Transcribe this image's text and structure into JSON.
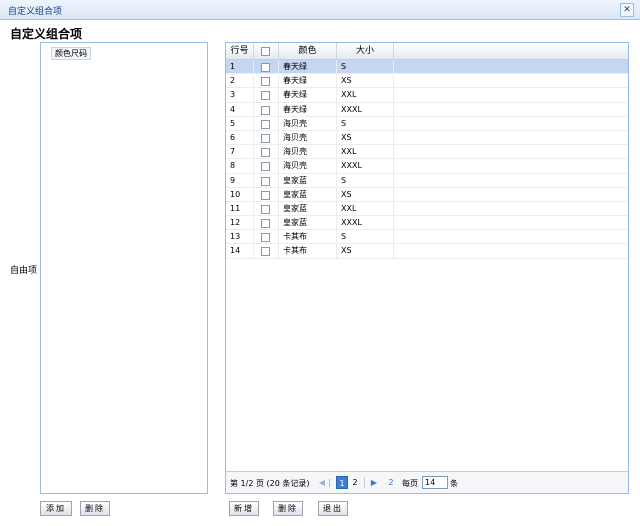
{
  "window": {
    "title": "自定义组合项",
    "close_glyph": "✕"
  },
  "dialog": {
    "heading": "自定义组合项",
    "side_label": "自由项"
  },
  "left_panel": {
    "chip_label": "颜色尺码"
  },
  "grid": {
    "columns": {
      "rownum": "行号",
      "color": "颜色",
      "size": "大小"
    },
    "rows": [
      {
        "n": "1",
        "color": "春天绿",
        "size": "S"
      },
      {
        "n": "2",
        "color": "春天绿",
        "size": "XS"
      },
      {
        "n": "3",
        "color": "春天绿",
        "size": "XXL"
      },
      {
        "n": "4",
        "color": "春天绿",
        "size": "XXXL"
      },
      {
        "n": "5",
        "color": "海贝壳",
        "size": "S"
      },
      {
        "n": "6",
        "color": "海贝壳",
        "size": "XS"
      },
      {
        "n": "7",
        "color": "海贝壳",
        "size": "XXL"
      },
      {
        "n": "8",
        "color": "海贝壳",
        "size": "XXXL"
      },
      {
        "n": "9",
        "color": "皇家蓝",
        "size": "S"
      },
      {
        "n": "10",
        "color": "皇家蓝",
        "size": "XS"
      },
      {
        "n": "11",
        "color": "皇家蓝",
        "size": "XXL"
      },
      {
        "n": "12",
        "color": "皇家蓝",
        "size": "XXXL"
      },
      {
        "n": "13",
        "color": "卡其布",
        "size": "S"
      },
      {
        "n": "14",
        "color": "卡其布",
        "size": "XS"
      }
    ],
    "selected_row": 0
  },
  "pager": {
    "info": "第  1/2 页  (20 条记录)",
    "prev_glyph": "◀",
    "pipe": "|",
    "page1": "1",
    "page2": "2",
    "next_glyph": "▶",
    "last_label": "2",
    "per_page_label": "每页",
    "per_page_value": "14",
    "unit": "条"
  },
  "buttons": {
    "add": "添加",
    "delete_left": "删除",
    "new": "新增",
    "delete": "删除",
    "exit": "退出"
  },
  "colors": {
    "accent": "#3c7fd0",
    "selected_row": "#c5d7f0",
    "border": "#99bbe8"
  }
}
